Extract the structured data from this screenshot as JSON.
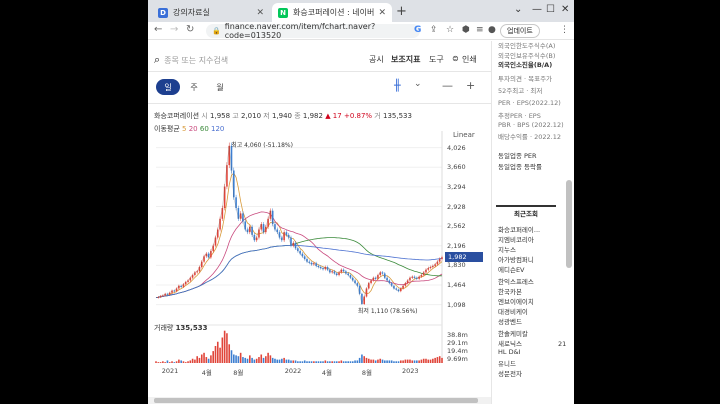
{
  "browser": {
    "tabs": [
      {
        "title": "강의자료실",
        "favicon_color": "#3a6fd8",
        "favicon_glyph": "D"
      },
      {
        "title": "화승코퍼레이션 : 네이버 증권",
        "favicon_color": "#03c75a",
        "favicon_glyph": "N"
      }
    ],
    "url": "finance.naver.com/item/fchart.naver?code=013520",
    "update_label": "업데이트"
  },
  "page": {
    "search_placeholder": "종목 또는 지수검색",
    "top_menu": [
      "공시",
      "보조지표",
      "도구"
    ],
    "print_label": "인쇄",
    "period_tabs": [
      "일",
      "주",
      "월"
    ],
    "active_period": "일",
    "quote": {
      "name": "화승코퍼레이션",
      "open_label": "시",
      "open": "1,958",
      "high_label": "고",
      "high": "2,010",
      "low_label": "저",
      "low": "1,940",
      "close_label": "종",
      "close": "1,982",
      "change": "▲ 17",
      "change_pct": "+0.87%",
      "volume_label": "거",
      "volume": "135,533"
    },
    "ma": {
      "label": "이동평균",
      "p5": "5",
      "p20": "20",
      "p60": "60",
      "p120": "120"
    },
    "scale_label": "Linear",
    "volume_title": "거래량",
    "volume_value": "135,533"
  },
  "chart_data": {
    "type": "line",
    "title": "",
    "price_axis_ticks": [
      "4,026",
      "3,660",
      "3,294",
      "2,928",
      "2,562",
      "2,196",
      "1,830",
      "1,464",
      "1,098"
    ],
    "price_ticks_values": [
      4026,
      3660,
      3294,
      2928,
      2562,
      2196,
      1830,
      1464,
      1098
    ],
    "current_price": "1,982",
    "current_price_value": 1982,
    "high_annotation": "최고 4,060 (-51.18%)",
    "low_annotation": "최저 1,110 (78.56%)",
    "volume_axis_ticks": [
      "38.8m",
      "29.1m",
      "19.4m",
      "9.69m"
    ],
    "x_labels": [
      "2021",
      "4월",
      "8월",
      "2022",
      "4월",
      "8월",
      "2023"
    ],
    "ylim": [
      980,
      4150
    ],
    "series": [
      {
        "name": "",
        "color": "#333333",
        "values": [
          1230,
          1240,
          1260,
          1270,
          1300,
          1290,
          1320,
          1360,
          1350,
          1400,
          1450,
          1430,
          1480,
          1520,
          1550,
          1600,
          1650,
          1700,
          1720,
          1800,
          1900,
          2000,
          2050,
          1980,
          2100,
          2200,
          2350,
          2500,
          2700,
          2900,
          3300,
          3700,
          4060,
          3600,
          3100,
          2900,
          2700,
          2800,
          2650,
          2500,
          2450,
          2550,
          2400,
          2300,
          2350,
          2500,
          2600,
          2450,
          2550,
          2700,
          2850,
          2600,
          2500,
          2450,
          2350,
          2300,
          2450,
          2400,
          2350,
          2200,
          2250,
          2150,
          2100,
          2050,
          2000,
          1950,
          1900,
          1880,
          1850,
          1870,
          1820,
          1800,
          1780,
          1760,
          1800,
          1750,
          1700,
          1720,
          1680,
          1650,
          1700,
          1750,
          1720,
          1680,
          1650,
          1600,
          1550,
          1500,
          1450,
          1300,
          1110,
          1250,
          1400,
          1500,
          1550,
          1600,
          1580,
          1650,
          1700,
          1680,
          1600,
          1550,
          1500,
          1450,
          1400,
          1380,
          1350,
          1400,
          1450,
          1500,
          1550,
          1600,
          1620,
          1600,
          1580,
          1620,
          1650,
          1700,
          1750,
          1780,
          1800,
          1820,
          1850,
          1900,
          1950,
          1982
        ]
      },
      {
        "name": "5",
        "color": "#d89a3a",
        "smoothing": 5
      },
      {
        "name": "20",
        "color": "#c94a7e",
        "smoothing": 20
      },
      {
        "name": "60",
        "color": "#3a8a3a",
        "smoothing": 60
      },
      {
        "name": "120",
        "color": "#4a6fd0",
        "smoothing": 120
      }
    ],
    "volume": [
      2,
      1,
      1,
      2,
      1,
      3,
      1,
      2,
      1,
      2,
      4,
      3,
      2,
      1,
      2,
      3,
      5,
      4,
      8,
      6,
      10,
      12,
      7,
      5,
      9,
      14,
      20,
      25,
      18,
      30,
      38,
      35,
      22,
      15,
      10,
      9,
      8,
      12,
      7,
      6,
      5,
      9,
      6,
      4,
      5,
      7,
      10,
      6,
      8,
      12,
      9,
      6,
      5,
      4,
      4,
      5,
      6,
      4,
      4,
      3,
      3,
      3,
      2,
      2,
      2,
      3,
      2,
      2,
      2,
      2,
      2,
      2,
      2,
      2,
      3,
      2,
      2,
      2,
      2,
      2,
      2,
      3,
      2,
      2,
      2,
      2,
      2,
      3,
      3,
      6,
      10,
      8,
      6,
      5,
      4,
      4,
      3,
      4,
      5,
      4,
      3,
      3,
      3,
      3,
      2,
      2,
      2,
      3,
      3,
      4,
      4,
      4,
      3,
      3,
      3,
      3,
      4,
      5,
      5,
      4,
      4,
      5,
      6,
      7,
      8,
      6
    ],
    "volume_ylim": [
      0,
      40
    ]
  },
  "sidebar": {
    "top_items": [
      "외국인한도주식수(A)",
      "외국인보유주식수(B)",
      "외국인소진율(B/A)",
      "투자의견 · 목표주가",
      "52주최고 · 최저",
      "PER · EPS(2022.12)",
      "추정PER · EPS",
      "PBR · BPS (2022.12)",
      "배당수익률 · 2022.12",
      "동일업종 PER",
      "동일업종 등락률"
    ],
    "recent_title": "최근조회",
    "recent_items": [
      "화승코퍼레이...",
      "지엠비코리아",
      "지누스",
      "아가방컴퍼니",
      "에디슨EV",
      "한익스프레스",
      "한국카본",
      "엔브이에이치",
      "대경비케이",
      "성광벤드",
      "한솔케미칼",
      "새로닉스",
      "HL D&I",
      "유니드",
      "성문전자"
    ],
    "num_marker": "21"
  }
}
